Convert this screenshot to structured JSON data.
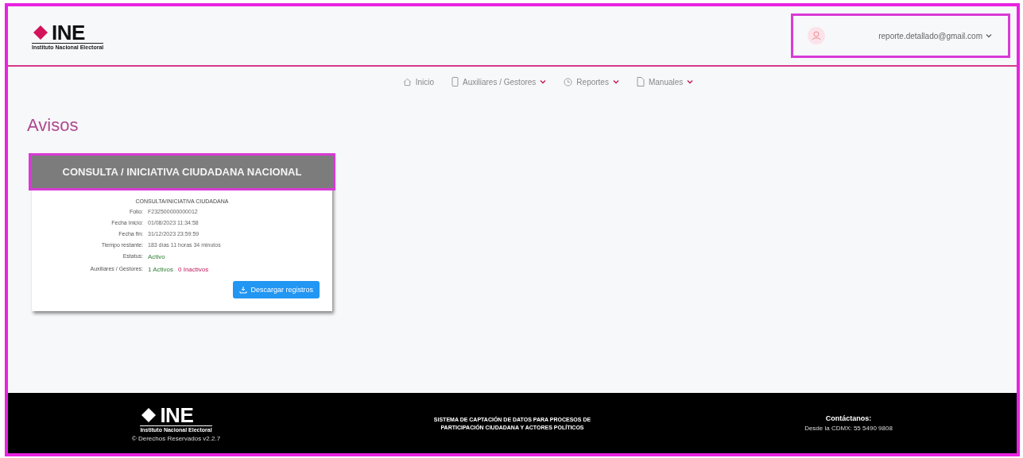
{
  "header": {
    "logo": {
      "text": "INE",
      "subtitle": "Instituto Nacional Electoral"
    },
    "user": {
      "email": "reporte.detallado@gmail.com"
    }
  },
  "nav": [
    {
      "label": "Inicio",
      "dropdown": false
    },
    {
      "label": "Auxiliares / Gestores",
      "dropdown": true
    },
    {
      "label": "Reportes",
      "dropdown": true
    },
    {
      "label": "Manuales",
      "dropdown": true
    }
  ],
  "page_title": "Avisos",
  "card": {
    "header": "CONSULTA / INICIATIVA CIUDADANA NACIONAL",
    "subtitle": "CONSULTA/INICIATIVA CIUDADANA",
    "fields": [
      {
        "label": "Folio:",
        "value": "F232500000000012"
      },
      {
        "label": "Fecha Inicio:",
        "value": "01/08/2023 11:34:58"
      },
      {
        "label": "Fecha fin:",
        "value": "31/12/2023 23:59:59"
      },
      {
        "label": "Tiempo restante:",
        "value": "183 días 11 horas 34 minutos"
      },
      {
        "label": "Estatus:",
        "value": "Activo",
        "kind": "status"
      }
    ],
    "gestores": {
      "label": "Auxiliares / Gestores:",
      "active": "1 Activos",
      "inactive": "0 Inactivos"
    },
    "button": "Descargar registros"
  },
  "footer": {
    "logo": {
      "text": "INE",
      "subtitle": "Instituto Nacional Electoral"
    },
    "copyright": "© Derechos Reservados v2.2.7",
    "system": [
      "SISTEMA DE CAPTACIÓN DE DATOS PARA PROCESOS DE",
      "PARTICIPACIÓN CIUDADANA Y ACTORES POLÍTICOS"
    ],
    "contact_title": "Contáctanos:",
    "contact": "Desde la CDMX: 55 5490 9808"
  }
}
